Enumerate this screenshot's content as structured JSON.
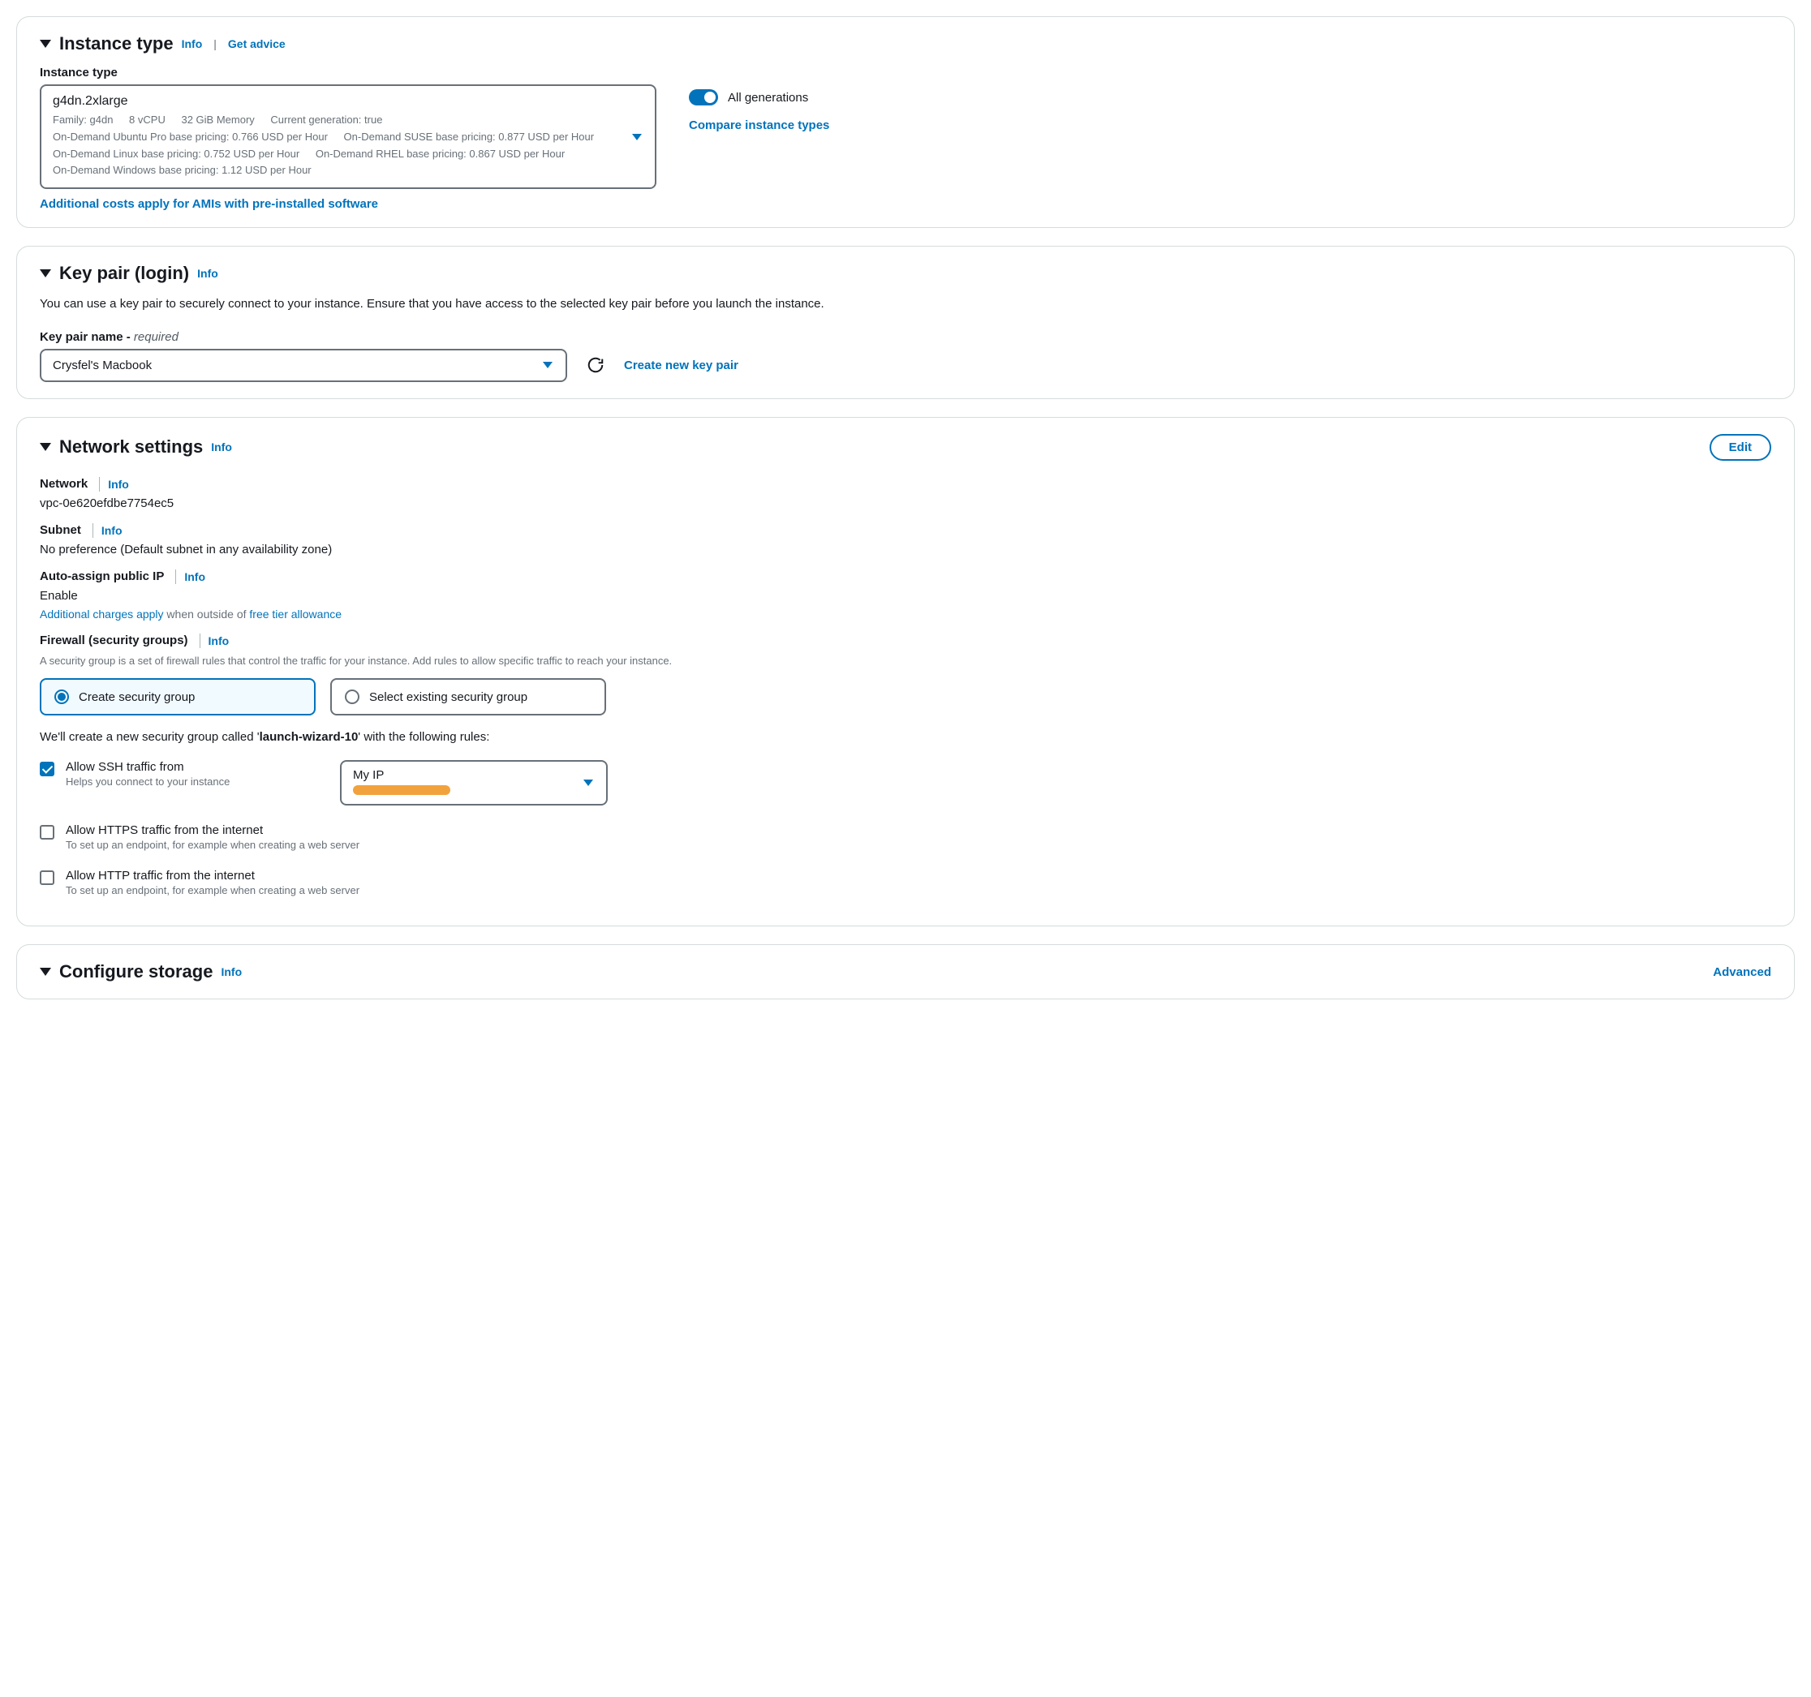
{
  "instanceType": {
    "title": "Instance type",
    "infoLabel": "Info",
    "adviceLabel": "Get advice",
    "fieldLabel": "Instance type",
    "selected": {
      "name": "g4dn.2xlarge",
      "family": "Family: g4dn",
      "vcpu": "8 vCPU",
      "memory": "32 GiB Memory",
      "currentGen": "Current generation: true",
      "pricing": {
        "ubuntu": "On-Demand Ubuntu Pro base pricing: 0.766 USD per Hour",
        "suse": "On-Demand SUSE base pricing: 0.877 USD per Hour",
        "linux": "On-Demand Linux base pricing: 0.752 USD per Hour",
        "rhel": "On-Demand RHEL base pricing: 0.867 USD per Hour",
        "windows": "On-Demand Windows base pricing: 1.12 USD per Hour"
      }
    },
    "allGenerationsLabel": "All generations",
    "compareLabel": "Compare instance types",
    "additionalCostsLabel": "Additional costs apply for AMIs with pre-installed software"
  },
  "keyPair": {
    "title": "Key pair (login)",
    "infoLabel": "Info",
    "description": "You can use a key pair to securely connect to your instance. Ensure that you have access to the selected key pair before you launch the instance.",
    "fieldLabel": "Key pair name - ",
    "required": "required",
    "selected": "Crysfel's Macbook",
    "createLabel": "Create new key pair"
  },
  "network": {
    "title": "Network settings",
    "infoLabel": "Info",
    "editLabel": "Edit",
    "networkLabel": "Network",
    "networkValue": "vpc-0e620efdbe7754ec5",
    "subnetLabel": "Subnet",
    "subnetValue": "No preference (Default subnet in any availability zone)",
    "publicIpLabel": "Auto-assign public IP",
    "publicIpValue": "Enable",
    "chargesNote1": "Additional charges apply",
    "chargesNote2": " when outside of ",
    "chargesNote3": "free tier allowance",
    "firewallLabel": "Firewall (security groups)",
    "firewallHint": "A security group is a set of firewall rules that control the traffic for your instance. Add rules to allow specific traffic to reach your instance.",
    "createSgLabel": "Create security group",
    "selectSgLabel": "Select existing security group",
    "sgNote1": "We'll create a new security group called '",
    "sgName": "launch-wizard-10",
    "sgNote2": "' with the following rules:",
    "sshLabel": "Allow SSH traffic from",
    "sshHint": "Helps you connect to your instance",
    "sshSource": "My IP",
    "httpsLabel": "Allow HTTPS traffic from the internet",
    "httpsHint": "To set up an endpoint, for example when creating a web server",
    "httpLabel": "Allow HTTP traffic from the internet",
    "httpHint": "To set up an endpoint, for example when creating a web server"
  },
  "storage": {
    "title": "Configure storage",
    "infoLabel": "Info",
    "advancedLabel": "Advanced"
  }
}
